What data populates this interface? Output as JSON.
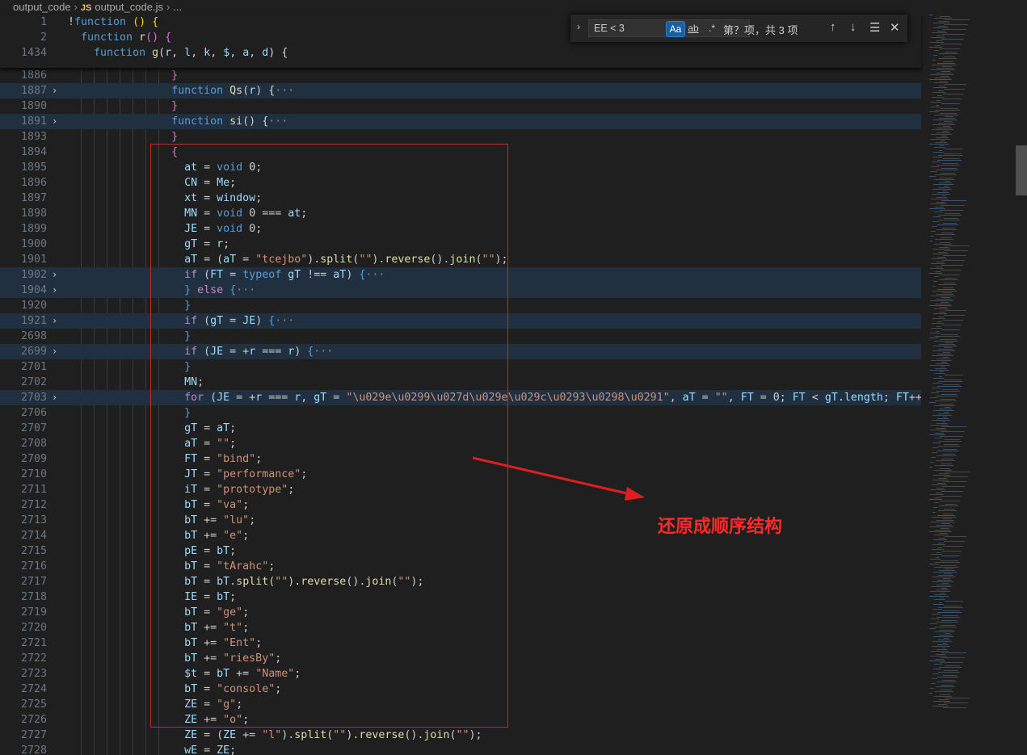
{
  "breadcrumb": {
    "folder": "output_code",
    "file_badge": "JS",
    "file": "output_code.js",
    "more": "..."
  },
  "find_widget": {
    "query": "EE < 3",
    "match_case": "Aa",
    "whole_word": "ab",
    "regex": ".*",
    "result": "第？项，共 3 项",
    "icons": [
      "chevron-right-icon",
      "arrow-up-icon",
      "arrow-down-icon",
      "list-selection-icon",
      "close-icon"
    ]
  },
  "annotation": "还原成顺序结构",
  "sticky_lines": [
    {
      "n": "1",
      "html": "<span class='pl'>!</span><span class='kw'>function</span><span class='pl'> </span><span class='br'>()</span><span class='pl'> </span><span class='br'>{</span>"
    },
    {
      "n": "2",
      "html": "  <span class='kw'>function</span> <span class='fn'>r</span><span class='br2'>()</span> <span class='br2'>{</span>"
    },
    {
      "n": "1434",
      "html": "    <span class='kw'>function</span> <span class='fn'>g</span><span class='pl'>(</span><span class='id'>r</span>, <span class='id'>l</span>, <span class='id'>k</span>, <span class='id'>$</span>, <span class='id'>a</span>, <span class='id'>d</span><span class='pl'>)</span> <span class='pl'>{</span>"
    }
  ],
  "code_lines": [
    {
      "n": "1886",
      "fold": "",
      "hl": false,
      "html": "                <span class='br2'>}</span>"
    },
    {
      "n": "1887",
      "fold": "›",
      "hl": true,
      "html": "                <span class='kw'>function</span> <span class='fn'>Qs</span>(<span class='id'>r</span>) <span class='pl'>{</span><span class='ell'>···</span>"
    },
    {
      "n": "1890",
      "fold": "",
      "hl": false,
      "html": "                <span class='br2'>}</span>"
    },
    {
      "n": "1891",
      "fold": "›",
      "hl": true,
      "html": "                <span class='kw'>function</span> <span class='fn'>si</span>() <span class='pl'>{</span><span class='ell'>···</span>"
    },
    {
      "n": "1893",
      "fold": "",
      "hl": false,
      "html": "                <span class='br2'>}</span>"
    },
    {
      "n": "1894",
      "fold": "",
      "hl": false,
      "html": "                <span class='br2'>{</span>"
    },
    {
      "n": "1895",
      "fold": "",
      "hl": false,
      "html": "                  <span class='id'>at</span> = <span class='kw'>void</span> <span class='pl'>0</span>;"
    },
    {
      "n": "1896",
      "fold": "",
      "hl": false,
      "html": "                  <span class='id'>CN</span> = <span class='id'>Me</span>;"
    },
    {
      "n": "1897",
      "fold": "",
      "hl": false,
      "html": "                  <span class='id'>xt</span> = <span class='id'>window</span>;"
    },
    {
      "n": "1898",
      "fold": "",
      "hl": false,
      "html": "                  <span class='id'>MN</span> = <span class='kw'>void</span> 0 === <span class='id'>at</span>;"
    },
    {
      "n": "1899",
      "fold": "",
      "hl": false,
      "html": "                  <span class='id'>JE</span> = <span class='kw'>void</span> 0;"
    },
    {
      "n": "1900",
      "fold": "",
      "hl": false,
      "html": "                  <span class='id'>gT</span> = <span class='id'>r</span>;"
    },
    {
      "n": "1901",
      "fold": "",
      "hl": false,
      "html": "                  <span class='id'>aT</span> = (<span class='id'>aT</span> = <span class='str'>\"tcejbo\"</span>).<span class='fn'>split</span>(<span class='str'>\"\"</span>).<span class='fn'>reverse</span>().<span class='fn'>join</span>(<span class='str'>\"\"</span>);"
    },
    {
      "n": "1902",
      "fold": "›",
      "hl": true,
      "html": "                  <span class='ctl'>if</span> (<span class='id'>FT</span> = <span class='kw'>typeof</span> <span class='id'>gT</span> !== <span class='id'>aT</span>) <span class='kw'>{</span><span class='ell'>···</span>"
    },
    {
      "n": "1904",
      "fold": "›",
      "hl": true,
      "html": "                  <span class='kw'>}</span> <span class='ctl'>else</span> <span class='kw'>{</span><span class='ell'>···</span>"
    },
    {
      "n": "1920",
      "fold": "",
      "hl": false,
      "html": "                  <span class='kw'>}</span>"
    },
    {
      "n": "1921",
      "fold": "›",
      "hl": true,
      "html": "                  <span class='ctl'>if</span> (<span class='id'>gT</span> = <span class='id'>JE</span>) <span class='kw'>{</span><span class='ell'>···</span>"
    },
    {
      "n": "2698",
      "fold": "",
      "hl": false,
      "html": "                  <span class='kw'>}</span>"
    },
    {
      "n": "2699",
      "fold": "›",
      "hl": true,
      "html": "                  <span class='ctl'>if</span> (<span class='id'>JE</span> = +<span class='id'>r</span> === <span class='id'>r</span>) <span class='kw'>{</span><span class='ell'>···</span>"
    },
    {
      "n": "2701",
      "fold": "",
      "hl": false,
      "html": "                  <span class='kw'>}</span>"
    },
    {
      "n": "2702",
      "fold": "",
      "hl": false,
      "html": "                  <span class='id'>MN</span>;"
    },
    {
      "n": "2703",
      "fold": "›",
      "hl": true,
      "html": "                  <span class='ctl'>for</span> (<span class='id'>JE</span> = +<span class='id'>r</span> === <span class='id'>r</span>, <span class='id'>gT</span> = <span class='str'>\"\\u029e\\u0299\\u027d\\u029e\\u029c\\u0293\\u0298\\u0291\"</span>, <span class='id'>aT</span> = <span class='str'>\"\"</span>, <span class='id'>FT</span> = 0; <span class='id'>FT</span> &lt; <span class='id'>gT</span>.<span class='id'>length</span>; <span class='id'>FT</span>++) <span class='kw'>{</span><span class='ell'>···</span>"
    },
    {
      "n": "2706",
      "fold": "",
      "hl": false,
      "html": "                  <span class='kw'>}</span>"
    },
    {
      "n": "2707",
      "fold": "",
      "hl": false,
      "html": "                  <span class='id'>gT</span> = <span class='id'>aT</span>;"
    },
    {
      "n": "2708",
      "fold": "",
      "hl": false,
      "html": "                  <span class='id'>aT</span> = <span class='str'>\"\"</span>;"
    },
    {
      "n": "2709",
      "fold": "",
      "hl": false,
      "html": "                  <span class='id'>FT</span> = <span class='str'>\"bind\"</span>;"
    },
    {
      "n": "2710",
      "fold": "",
      "hl": false,
      "html": "                  <span class='id'>JT</span> = <span class='str'>\"performance\"</span>;"
    },
    {
      "n": "2711",
      "fold": "",
      "hl": false,
      "html": "                  <span class='id'>iT</span> = <span class='str'>\"prototype\"</span>;"
    },
    {
      "n": "2712",
      "fold": "",
      "hl": false,
      "html": "                  <span class='id'>bT</span> = <span class='str'>\"va\"</span>;"
    },
    {
      "n": "2713",
      "fold": "",
      "hl": false,
      "html": "                  <span class='id'>bT</span> += <span class='str'>\"lu\"</span>;"
    },
    {
      "n": "2714",
      "fold": "",
      "hl": false,
      "html": "                  <span class='id'>bT</span> += <span class='str'>\"e\"</span>;"
    },
    {
      "n": "2715",
      "fold": "",
      "hl": false,
      "html": "                  <span class='id'>pE</span> = <span class='id'>bT</span>;"
    },
    {
      "n": "2716",
      "fold": "",
      "hl": false,
      "html": "                  <span class='id'>bT</span> = <span class='str'>\"tArahc\"</span>;"
    },
    {
      "n": "2717",
      "fold": "",
      "hl": false,
      "html": "                  <span class='id'>bT</span> = <span class='id'>bT</span>.<span class='fn'>split</span>(<span class='str'>\"\"</span>).<span class='fn'>reverse</span>().<span class='fn'>join</span>(<span class='str'>\"\"</span>);"
    },
    {
      "n": "2718",
      "fold": "",
      "hl": false,
      "html": "                  <span class='id'>IE</span> = <span class='id'>bT</span>;"
    },
    {
      "n": "2719",
      "fold": "",
      "hl": false,
      "html": "                  <span class='id'>bT</span> = <span class='str'>\"ge\"</span>;"
    },
    {
      "n": "2720",
      "fold": "",
      "hl": false,
      "html": "                  <span class='id'>bT</span> += <span class='str'>\"t\"</span>;"
    },
    {
      "n": "2721",
      "fold": "",
      "hl": false,
      "html": "                  <span class='id'>bT</span> += <span class='str'>\"Ent\"</span>;"
    },
    {
      "n": "2722",
      "fold": "",
      "hl": false,
      "html": "                  <span class='id'>bT</span> += <span class='str'>\"riesBy\"</span>;"
    },
    {
      "n": "2723",
      "fold": "",
      "hl": false,
      "html": "                  <span class='id'>$t</span> = <span class='id'>bT</span> += <span class='str'>\"Name\"</span>;"
    },
    {
      "n": "2724",
      "fold": "",
      "hl": false,
      "html": "                  <span class='id'>bT</span> = <span class='str'>\"console\"</span>;"
    },
    {
      "n": "2725",
      "fold": "",
      "hl": false,
      "html": "                  <span class='id'>ZE</span> = <span class='str'>\"g\"</span>;"
    },
    {
      "n": "2726",
      "fold": "",
      "hl": false,
      "html": "                  <span class='id'>ZE</span> += <span class='str'>\"o\"</span>;"
    },
    {
      "n": "2727",
      "fold": "",
      "hl": false,
      "html": "                  <span class='id'>ZE</span> = (<span class='id'>ZE</span> += <span class='str'>\"l\"</span>).<span class='fn'>split</span>(<span class='str'>\"\"</span>).<span class='fn'>reverse</span>().<span class='fn'>join</span>(<span class='str'>\"\"</span>);"
    },
    {
      "n": "2728",
      "fold": "",
      "hl": false,
      "html": "                  <span class='id'>wE</span> = <span class='id'>ZE</span>;"
    }
  ]
}
